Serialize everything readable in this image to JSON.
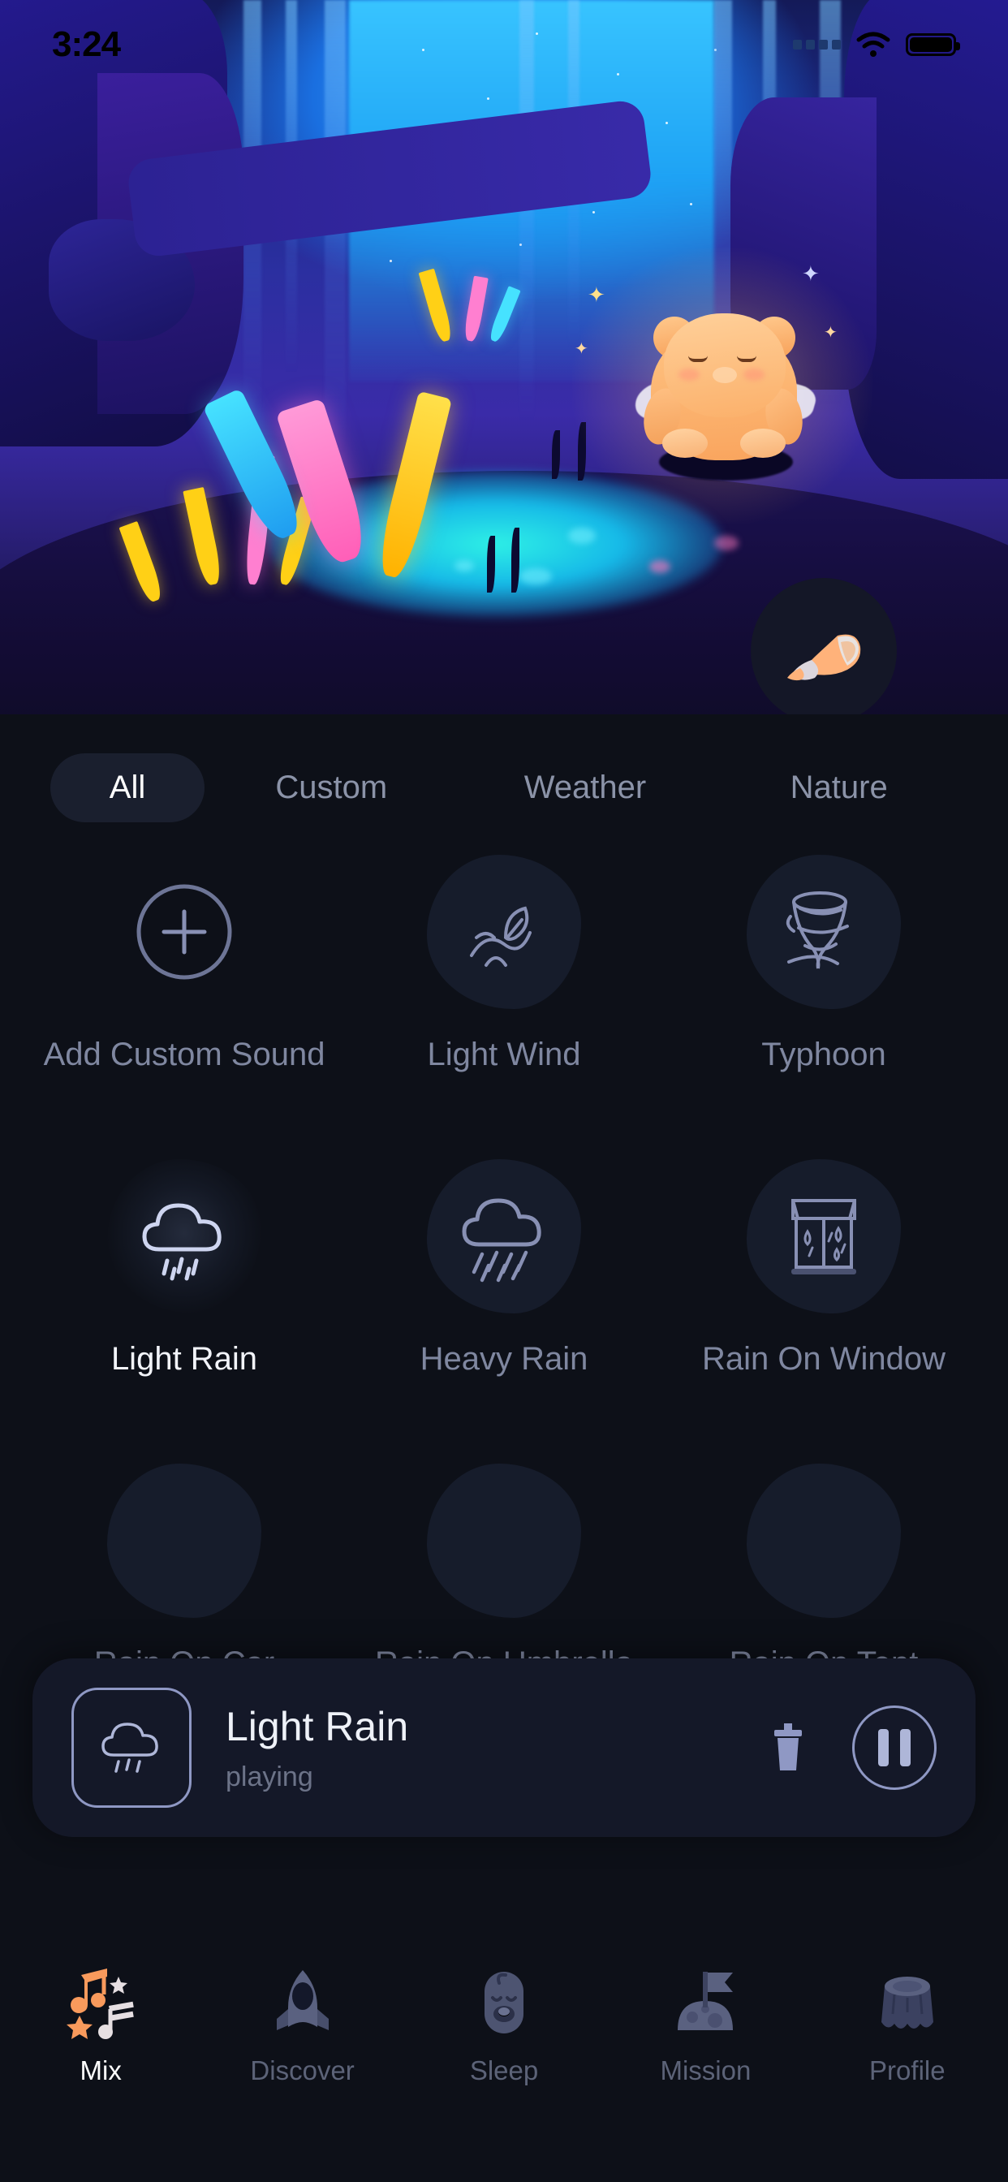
{
  "status_bar": {
    "time": "3:24",
    "signal_icon": "signal-dots-icon",
    "wifi_icon": "wifi-icon",
    "battery_icon": "battery-full-icon"
  },
  "hero": {
    "scene_name": "night-forest-scene",
    "character": "sleeping-bear-character",
    "floating_button": {
      "name": "shell-button",
      "icon": "seashell-icon"
    }
  },
  "tabs": {
    "active": "All",
    "items": [
      {
        "label": "All",
        "active": true
      },
      {
        "label": "Custom",
        "active": false
      },
      {
        "label": "Weather",
        "active": false
      },
      {
        "label": "Nature",
        "active": false
      }
    ]
  },
  "sounds": {
    "rows": [
      [
        {
          "label": "Add Custom Sound",
          "icon": "plus-circle-icon",
          "active": false,
          "has_blob": false
        },
        {
          "label": "Light Wind",
          "icon": "leaf-wind-icon",
          "active": false,
          "has_blob": true
        },
        {
          "label": "Typhoon",
          "icon": "tornado-icon",
          "active": false,
          "has_blob": true
        }
      ],
      [
        {
          "label": "Light Rain",
          "icon": "cloud-light-rain-icon",
          "active": true,
          "has_blob": true
        },
        {
          "label": "Heavy Rain",
          "icon": "cloud-heavy-rain-icon",
          "active": false,
          "has_blob": true
        },
        {
          "label": "Rain On Window",
          "icon": "rain-window-icon",
          "active": false,
          "has_blob": true
        }
      ],
      [
        {
          "label": "Rain On Car",
          "icon": "rain-car-icon",
          "active": false,
          "has_blob": true
        },
        {
          "label": "Rain On Umbrella",
          "icon": "rain-umbrella-icon",
          "active": false,
          "has_blob": true
        },
        {
          "label": "Rain On Tent",
          "icon": "rain-tent-icon",
          "active": false,
          "has_blob": true
        }
      ]
    ]
  },
  "player": {
    "thumb_icon": "cloud-light-rain-icon",
    "title": "Light Rain",
    "status": "playing",
    "delete_icon": "trash-icon",
    "playback_icon": "pause-icon"
  },
  "bottom_nav": {
    "active": "Mix",
    "items": [
      {
        "label": "Mix",
        "icon": "music-notes-stars-icon",
        "active": true
      },
      {
        "label": "Discover",
        "icon": "rocket-icon",
        "active": false
      },
      {
        "label": "Sleep",
        "icon": "sleeping-baby-icon",
        "active": false
      },
      {
        "label": "Mission",
        "icon": "flag-hill-icon",
        "active": false
      },
      {
        "label": "Profile",
        "icon": "tree-stump-icon",
        "active": false
      }
    ]
  },
  "colors": {
    "background": "#0d1018",
    "card": "#141828",
    "blob": "#161c2b",
    "accent_orange": "#f89a5c",
    "text_primary": "#f2f4fa",
    "text_muted": "#7f87a0"
  }
}
